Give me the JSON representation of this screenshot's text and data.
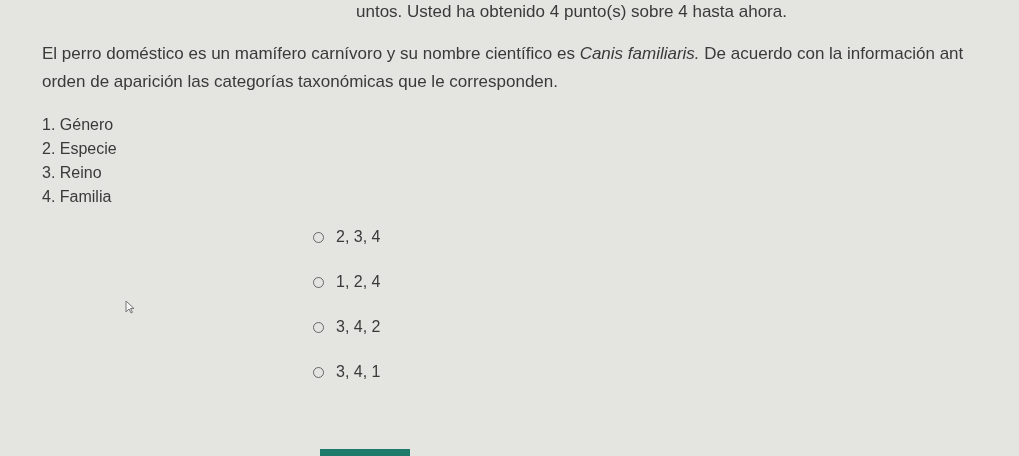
{
  "score_line": "untos. Usted ha obtenido 4 punto(s) sobre 4 hasta ahora.",
  "question": {
    "lines": [
      "El perro doméstico es un mamífero carnívoro y su nombre científico es *Canis familiaris.* De acuerdo con la información ant",
      "orden de aparición las categorías taxonómicas que le corresponden."
    ]
  },
  "items": [
    "1. Género",
    "2. Especie",
    "3. Reino",
    "4. Familia"
  ],
  "options": [
    {
      "label": "2, 3, 4",
      "selected": false
    },
    {
      "label": "1, 2, 4",
      "selected": false
    },
    {
      "label": "3, 4, 2",
      "selected": false
    },
    {
      "label": "3, 4, 1",
      "selected": false
    }
  ]
}
